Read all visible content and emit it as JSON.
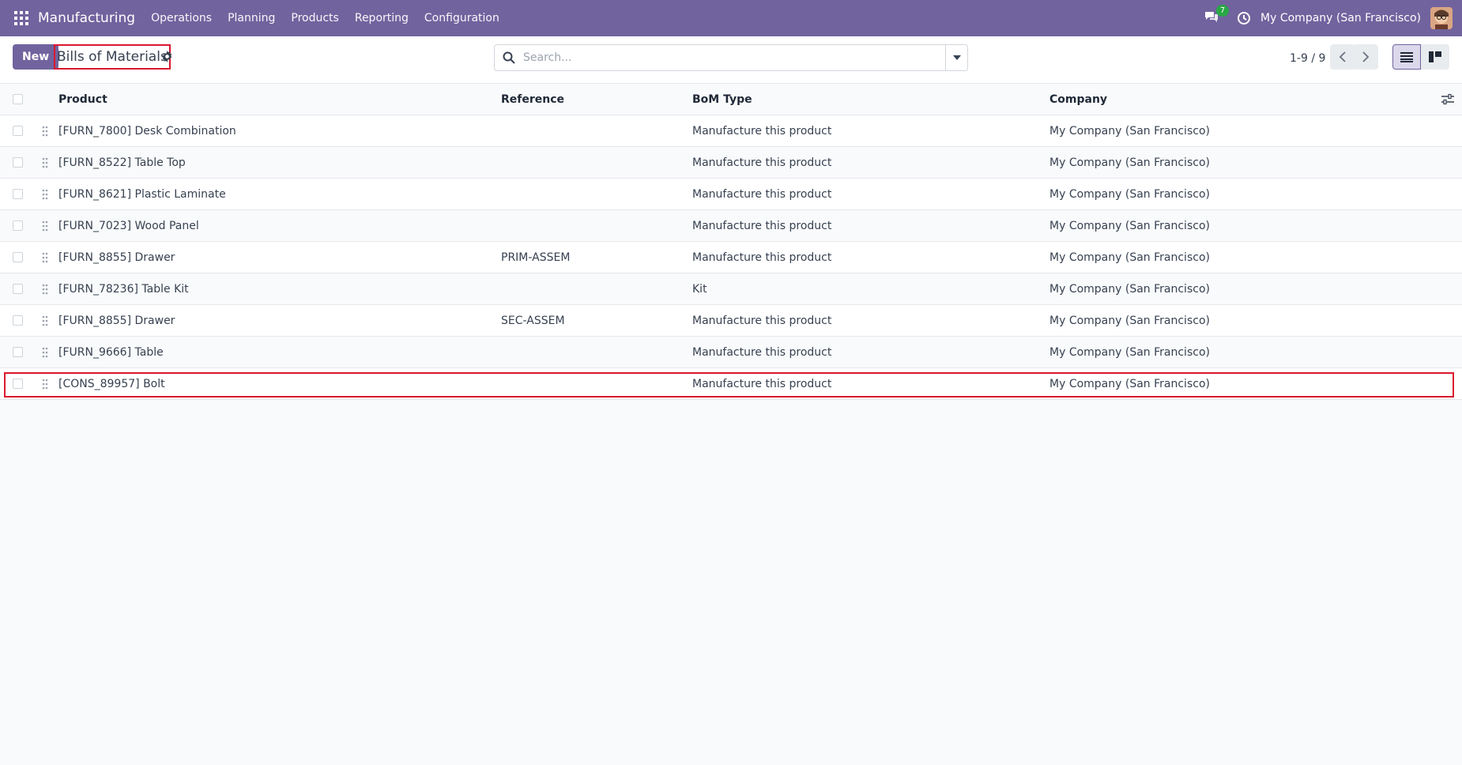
{
  "navbar": {
    "app_name": "Manufacturing",
    "menu": [
      "Operations",
      "Planning",
      "Products",
      "Reporting",
      "Configuration"
    ],
    "chat_count": "7",
    "company": "My Company (San Francisco)"
  },
  "control": {
    "new_label": "New",
    "title": "Bills of Materials",
    "search_placeholder": "Search...",
    "pager": "1-9 / 9"
  },
  "table": {
    "headers": {
      "product": "Product",
      "reference": "Reference",
      "bom_type": "BoM Type",
      "company": "Company"
    },
    "rows": [
      {
        "product": "[FURN_7800] Desk Combination",
        "reference": "",
        "bom_type": "Manufacture this product",
        "company": "My Company (San Francisco)"
      },
      {
        "product": "[FURN_8522] Table Top",
        "reference": "",
        "bom_type": "Manufacture this product",
        "company": "My Company (San Francisco)"
      },
      {
        "product": "[FURN_8621] Plastic Laminate",
        "reference": "",
        "bom_type": "Manufacture this product",
        "company": "My Company (San Francisco)"
      },
      {
        "product": "[FURN_7023] Wood Panel",
        "reference": "",
        "bom_type": "Manufacture this product",
        "company": "My Company (San Francisco)"
      },
      {
        "product": "[FURN_8855] Drawer",
        "reference": "PRIM-ASSEM",
        "bom_type": "Manufacture this product",
        "company": "My Company (San Francisco)"
      },
      {
        "product": "[FURN_78236] Table Kit",
        "reference": "",
        "bom_type": "Kit",
        "company": "My Company (San Francisco)"
      },
      {
        "product": "[FURN_8855] Drawer",
        "reference": "SEC-ASSEM",
        "bom_type": "Manufacture this product",
        "company": "My Company (San Francisco)"
      },
      {
        "product": "[FURN_9666] Table",
        "reference": "",
        "bom_type": "Manufacture this product",
        "company": "My Company (San Francisco)"
      },
      {
        "product": "[CONS_89957] Bolt",
        "reference": "",
        "bom_type": "Manufacture this product",
        "company": "My Company (San Francisco)"
      }
    ]
  },
  "colors": {
    "navbar": "#71639e",
    "accent": "#71639e",
    "highlight": "#d9182e",
    "badge": "#28a745"
  }
}
